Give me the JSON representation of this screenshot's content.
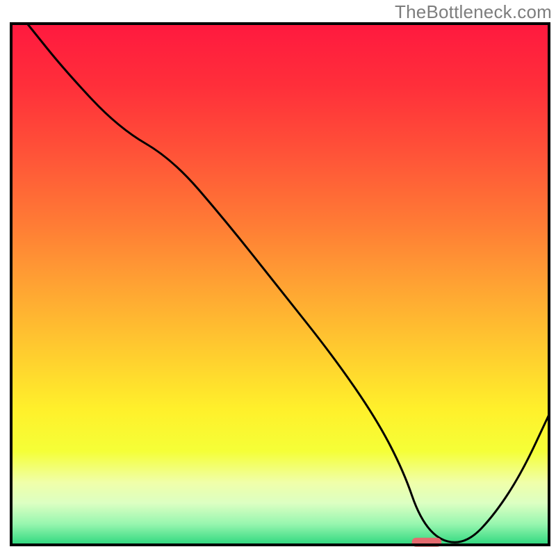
{
  "watermark": "TheBottleneck.com",
  "colors": {
    "frame": "#000000",
    "curve": "#000000",
    "marker_fill": "#e46a6e",
    "gradient_stops": [
      {
        "offset": 0.0,
        "color": "#ff193f"
      },
      {
        "offset": 0.12,
        "color": "#ff2f3a"
      },
      {
        "offset": 0.25,
        "color": "#ff5338"
      },
      {
        "offset": 0.38,
        "color": "#ff7a35"
      },
      {
        "offset": 0.5,
        "color": "#ffa233"
      },
      {
        "offset": 0.62,
        "color": "#ffc92f"
      },
      {
        "offset": 0.74,
        "color": "#fff02b"
      },
      {
        "offset": 0.82,
        "color": "#f5ff37"
      },
      {
        "offset": 0.88,
        "color": "#f0ffa9"
      },
      {
        "offset": 0.92,
        "color": "#dcffc2"
      },
      {
        "offset": 0.96,
        "color": "#97f6af"
      },
      {
        "offset": 1.0,
        "color": "#2dd87e"
      }
    ]
  },
  "chart_data": {
    "type": "line",
    "title": "",
    "xlabel": "",
    "ylabel": "",
    "xlim": [
      0,
      100
    ],
    "ylim": [
      0,
      100
    ],
    "x": [
      3,
      10,
      20,
      30,
      40,
      50,
      60,
      68,
      73,
      76,
      80,
      85,
      90,
      95,
      100
    ],
    "values": [
      100,
      91,
      80,
      74,
      62,
      49,
      36,
      24,
      14,
      5,
      0.5,
      0.5,
      6,
      14,
      25
    ],
    "marker": {
      "x_start": 74.5,
      "x_end": 80,
      "y": 0.5
    },
    "annotations": []
  }
}
